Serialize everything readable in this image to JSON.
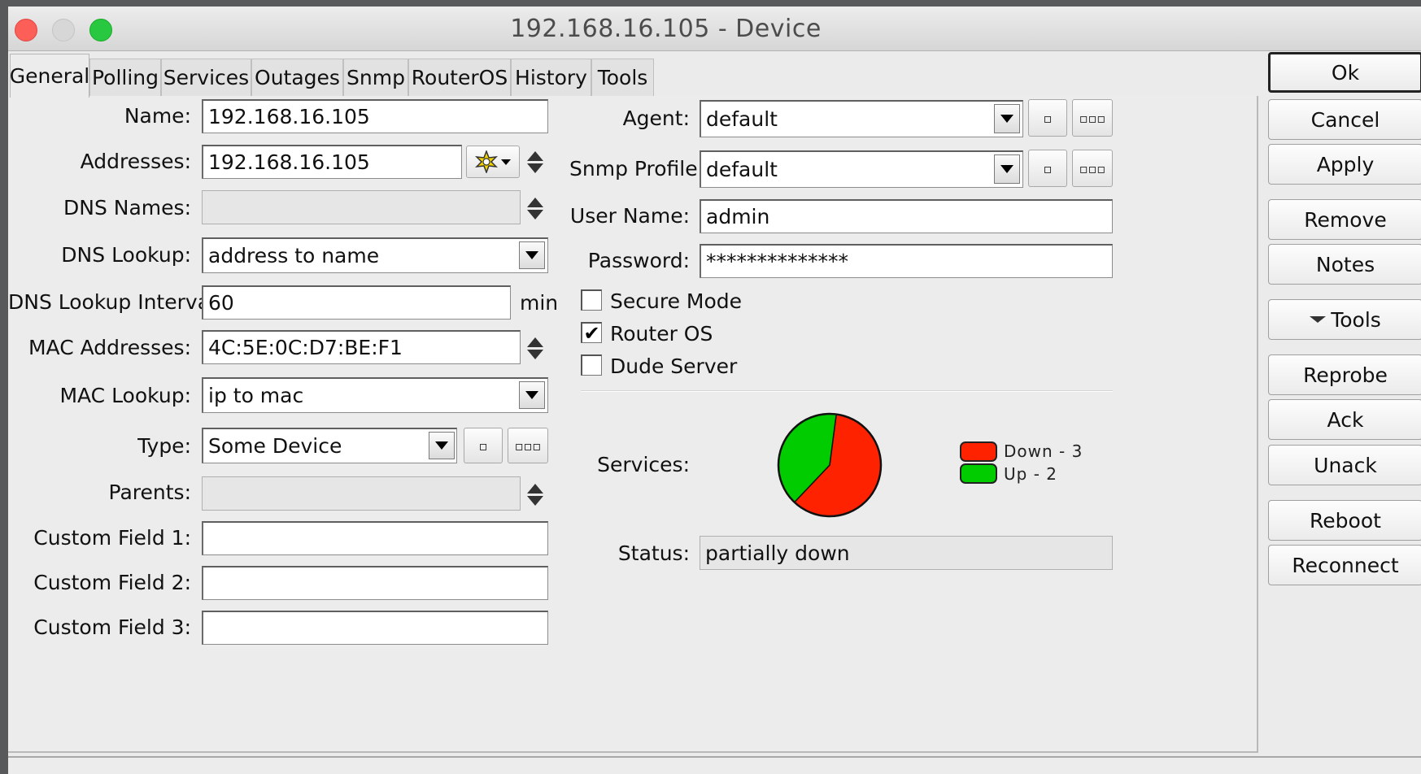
{
  "window": {
    "title": "192.168.16.105 - Device"
  },
  "tabs": [
    "General",
    "Polling",
    "Services",
    "Outages",
    "Snmp",
    "RouterOS",
    "History",
    "Tools"
  ],
  "active_tab": "General",
  "form": {
    "name": {
      "label": "Name:",
      "value": "192.168.16.105"
    },
    "addresses": {
      "label": "Addresses:",
      "value": "192.168.16.105"
    },
    "dns_names": {
      "label": "DNS Names:",
      "value": ""
    },
    "dns_lookup": {
      "label": "DNS Lookup:",
      "value": "address to name"
    },
    "dns_lookup_interval": {
      "label": "DNS Lookup Interval:",
      "value": "60",
      "unit": "min"
    },
    "mac_addresses": {
      "label": "MAC Addresses:",
      "value": "4C:5E:0C:D7:BE:F1"
    },
    "mac_lookup": {
      "label": "MAC Lookup:",
      "value": "ip to mac"
    },
    "type": {
      "label": "Type:",
      "value": "Some Device",
      "btn_small": "▫",
      "btn_more": "▫▫▫"
    },
    "parents": {
      "label": "Parents:",
      "value": ""
    },
    "custom1": {
      "label": "Custom Field 1:",
      "value": ""
    },
    "custom2": {
      "label": "Custom Field 2:",
      "value": ""
    },
    "custom3": {
      "label": "Custom Field 3:",
      "value": ""
    },
    "agent": {
      "label": "Agent:",
      "value": "default",
      "btn_small": "▫",
      "btn_more": "▫▫▫"
    },
    "snmp_profile": {
      "label": "Snmp Profile:",
      "value": "default",
      "btn_small": "▫",
      "btn_more": "▫▫▫"
    },
    "user_name": {
      "label": "User Name:",
      "value": "admin"
    },
    "password": {
      "label": "Password:",
      "value": "**************"
    },
    "secure_mode": {
      "label": "Secure Mode",
      "checked": false
    },
    "router_os": {
      "label": "Router OS",
      "checked": true,
      "mark": "✔"
    },
    "dude_server": {
      "label": "Dude Server",
      "checked": false
    },
    "services": {
      "label": "Services:"
    },
    "status": {
      "label": "Status:",
      "value": "partially down"
    }
  },
  "chart_data": {
    "type": "pie",
    "categories": [
      "Down",
      "Up"
    ],
    "values": [
      3,
      2
    ],
    "colors": [
      "#ff2200",
      "#00cc00"
    ],
    "legend": [
      {
        "text": "Down - 3",
        "color": "#ff2200"
      },
      {
        "text": "Up - 2",
        "color": "#00cc00"
      }
    ],
    "legend_position": "right"
  },
  "buttons": {
    "ok": "Ok",
    "cancel": "Cancel",
    "apply": "Apply",
    "remove": "Remove",
    "notes": "Notes",
    "tools": "Tools",
    "reprobe": "Reprobe",
    "ack": "Ack",
    "unack": "Unack",
    "reboot": "Reboot",
    "reconnect": "Reconnect"
  }
}
